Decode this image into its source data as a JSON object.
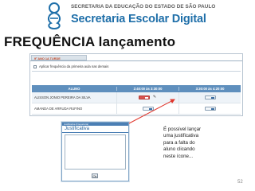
{
  "logo": {
    "top_text": "SECRETARIA DA EDUCAÇÃO DO ESTADO DE SÃO PAULO",
    "main_text": "Secretaria Escolar Digital"
  },
  "slide": {
    "title": "FREQUÊNCIA lançamento",
    "page_number": "52"
  },
  "app": {
    "tab_label": "9º ANO 1A TURDE",
    "apply_first_class_label": "Aplicar frequência da primeira aula nas demais",
    "grid": {
      "headers": [
        "ALUNO",
        "2:40:00 às 3:30:00",
        "3:30:00 às 4:20:00"
      ],
      "rows": [
        {
          "name": "ALISSON JONIO PEREIRA DA SILVA"
        },
        {
          "name": "AMANDA DE ARRUDA RUFINO"
        }
      ]
    }
  },
  "popup": {
    "bar_text": "Justificativa (Frequência)",
    "title": "Justificativa",
    "ok_label": "Ok"
  },
  "annotation": {
    "lines": [
      "É possível lançar",
      "uma justificativa",
      "para a falta do",
      "aluno clicando",
      "neste ícone..."
    ]
  },
  "colors": {
    "brand_blue": "#1f6fa9",
    "grid_header": "#5f8fbd",
    "absence_red": "#d9534f",
    "arrow_red": "#e0352b"
  },
  "icons": {
    "logo": "graduation-logo-icon",
    "edit": "pencil-icon"
  }
}
